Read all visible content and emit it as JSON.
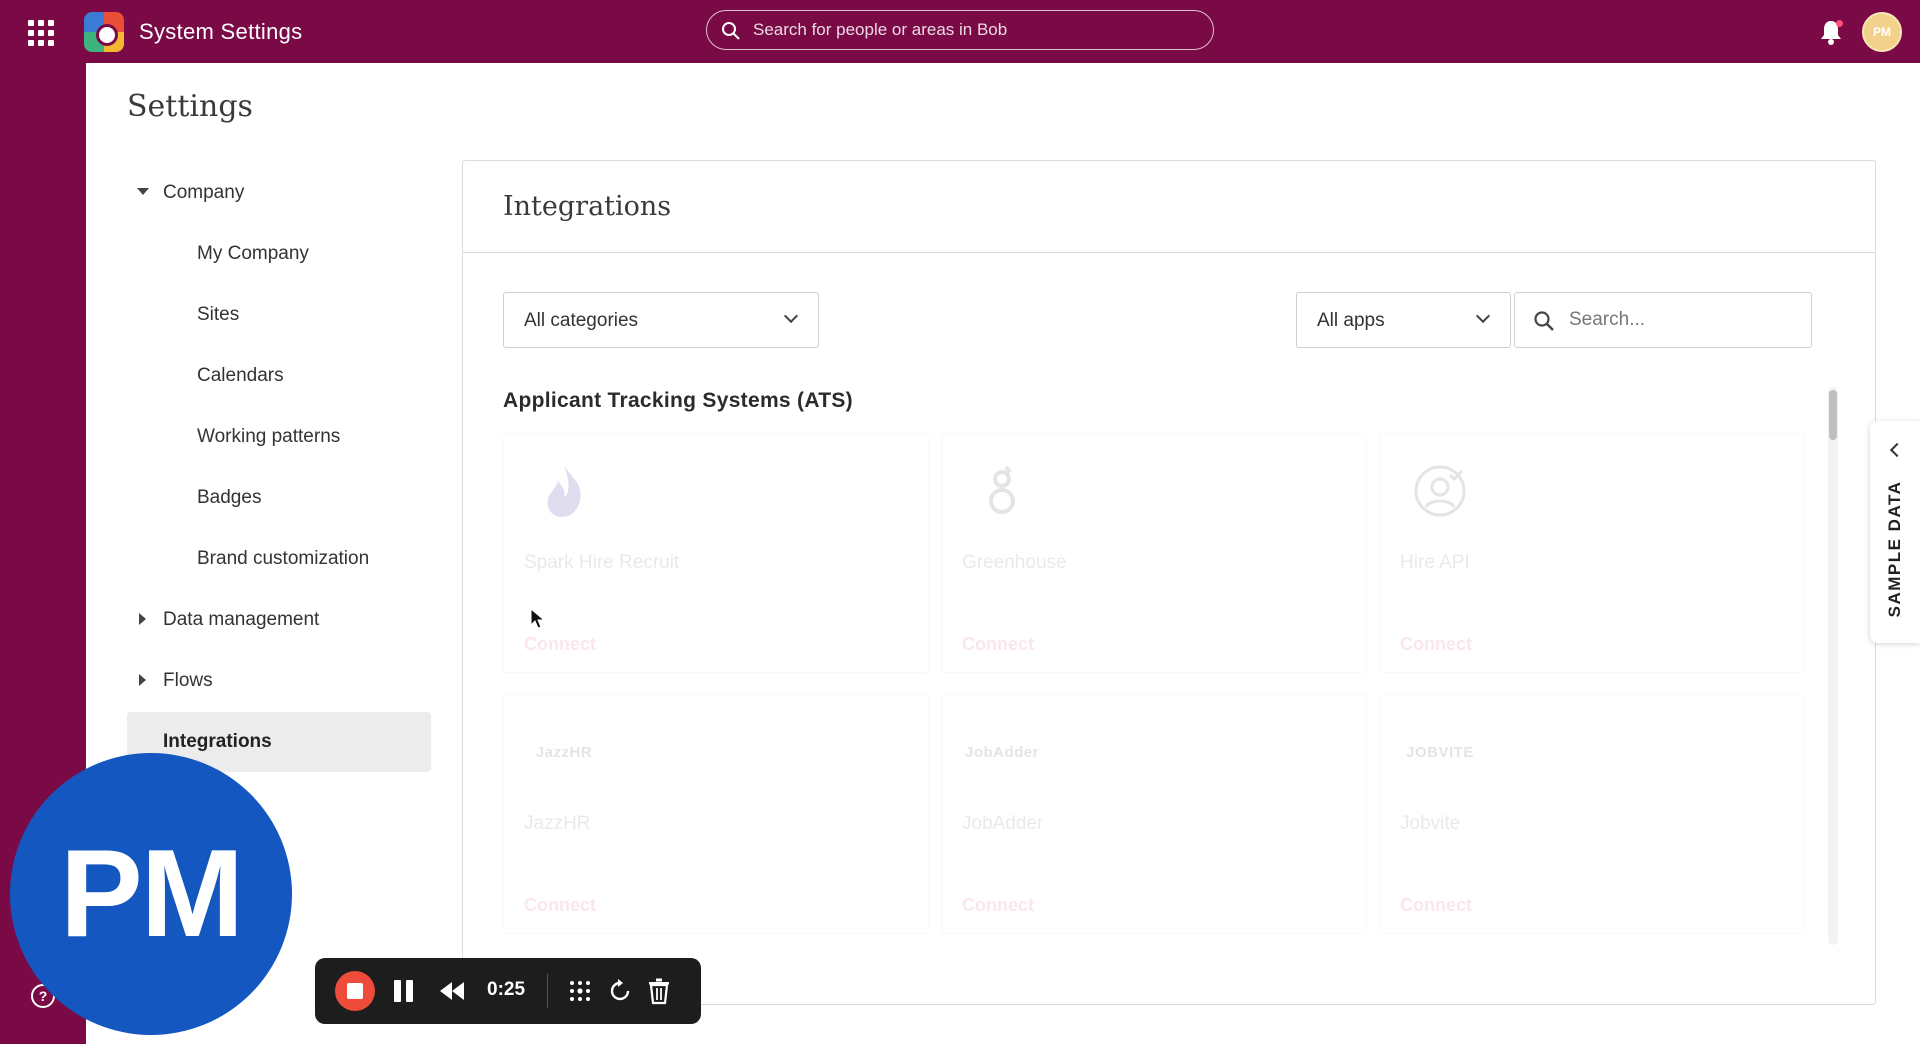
{
  "topbar": {
    "title": "System Settings",
    "search_placeholder": "Search for people or areas in Bob",
    "avatar_initials": "PM",
    "icons": [
      "apps-grid-icon",
      "app-logo",
      "search-icon",
      "bell-icon"
    ]
  },
  "page": {
    "title": "Settings"
  },
  "nav": {
    "company": "Company",
    "my_company": "My Company",
    "sites": "Sites",
    "calendars": "Calendars",
    "working_patterns": "Working patterns",
    "badges": "Badges",
    "brand_customization": "Brand customization",
    "data_management": "Data management",
    "flows": "Flows",
    "integrations": "Integrations"
  },
  "integrations": {
    "title": "Integrations",
    "category_select": "All categories",
    "apps_select": "All apps",
    "search_placeholder": "Search...",
    "group_title": "Applicant Tracking Systems (ATS)",
    "cards": [
      {
        "name": "Spark Hire Recruit",
        "connect": "Connect",
        "icon": "flame-logo"
      },
      {
        "name": "Greenhouse",
        "connect": "Connect",
        "icon": "greenhouse-logo"
      },
      {
        "name": "Hire API",
        "connect": "Connect",
        "icon": "person-check-logo"
      },
      {
        "name": "JazzHR",
        "connect": "Connect",
        "logo_text": "JazzHR",
        "icon": "jazzhr-logo"
      },
      {
        "name": "JobAdder",
        "connect": "Connect",
        "logo_text": "JobAdder",
        "icon": "jobadder-logo"
      },
      {
        "name": "Jobvite",
        "connect": "Connect",
        "logo_text": "JOBVITE",
        "icon": "jobvite-logo"
      }
    ]
  },
  "sample_tab": {
    "label": "SAMPLE DATA"
  },
  "webcam": {
    "initials": "PM"
  },
  "recorder": {
    "time": "0:25"
  },
  "colors": {
    "brand": "#7a0a46",
    "connect": "#e4336f",
    "webcam": "#1557c0",
    "record": "#ee4b3a"
  }
}
